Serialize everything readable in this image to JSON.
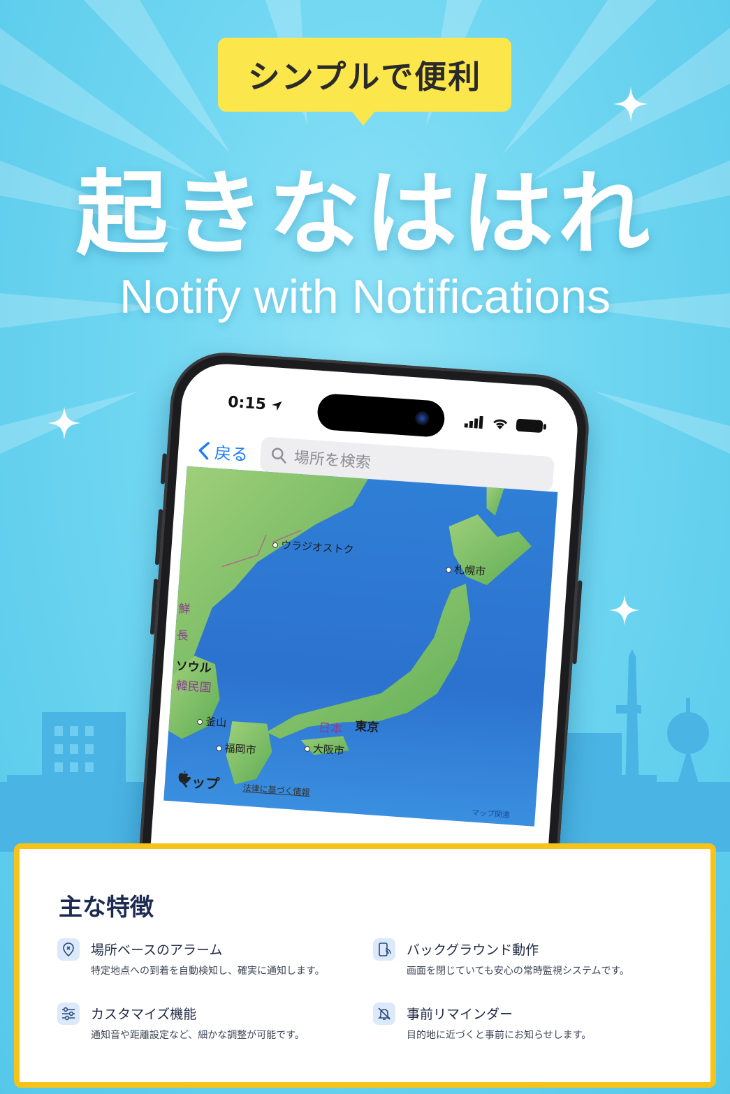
{
  "header": {
    "badge": "シンプルで便利",
    "title": "起きなははれ",
    "subtitle": "Notify with Notifications"
  },
  "phone": {
    "status_time": "0:15",
    "back_label": "戻る",
    "search_placeholder": "場所を検索",
    "map": {
      "labels": {
        "vladivostok": "ウラジオストク",
        "sapporo": "札幌市",
        "korea_partial": "鮮",
        "korea_partial2": "長",
        "seoul": "ソウル",
        "south_korea": "韓民国",
        "busan": "釜山",
        "japan": "日本",
        "tokyo": "東京",
        "osaka": "大阪市",
        "fukuoka": "福岡市"
      },
      "apple_maps": "マップ",
      "legal": "法律に基づく情報",
      "attribution": "マップ関連"
    }
  },
  "features": {
    "title": "主な特徴",
    "items": [
      {
        "title": "場所ベースのアラーム",
        "desc": "特定地点への到着を自動検知し、確実に通知します。",
        "icon": "location-pin-icon"
      },
      {
        "title": "バックグラウンド動作",
        "desc": "画面を閉じていても安心の常時監視システムです。",
        "icon": "phone-signal-icon"
      },
      {
        "title": "カスタマイズ機能",
        "desc": "通知音や距離設定など、細かな調整が可能です。",
        "icon": "sliders-icon"
      },
      {
        "title": "事前リマインダー",
        "desc": "目的地に近づくと事前にお知らせします。",
        "icon": "bell-off-icon"
      }
    ]
  },
  "colors": {
    "background": "#6fd6f1",
    "badge": "#fbe64b",
    "card_border": "#f6c418",
    "link_blue": "#1e7ef5"
  }
}
